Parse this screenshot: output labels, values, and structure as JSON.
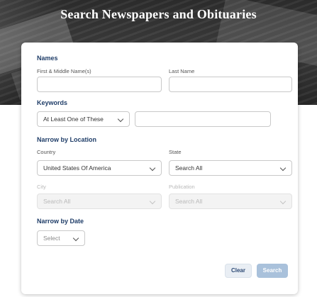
{
  "header": {
    "title": "Search Newspapers and Obituaries"
  },
  "form": {
    "names": {
      "section": "Names",
      "first_label": "First & Middle Name(s)",
      "last_label": "Last Name",
      "first_value": "",
      "last_value": ""
    },
    "keywords": {
      "section": "Keywords",
      "mode_value": "At Least One of These",
      "keyword_value": ""
    },
    "location": {
      "section": "Narrow by Location",
      "country_label": "Country",
      "country_value": "United States Of America",
      "state_label": "State",
      "state_value": "Search All",
      "city_label": "City",
      "city_value": "Search All",
      "publication_label": "Publication",
      "publication_value": "Search All"
    },
    "date": {
      "section": "Narrow by Date",
      "date_value": "Select"
    },
    "buttons": {
      "clear": "Clear",
      "search": "Search"
    }
  },
  "colors": {
    "section_title": "#1f3d68",
    "search_button_disabled": "#a9c1db",
    "clear_button_text": "#2d4a75"
  },
  "icons": [
    "chevron-down-icon"
  ]
}
